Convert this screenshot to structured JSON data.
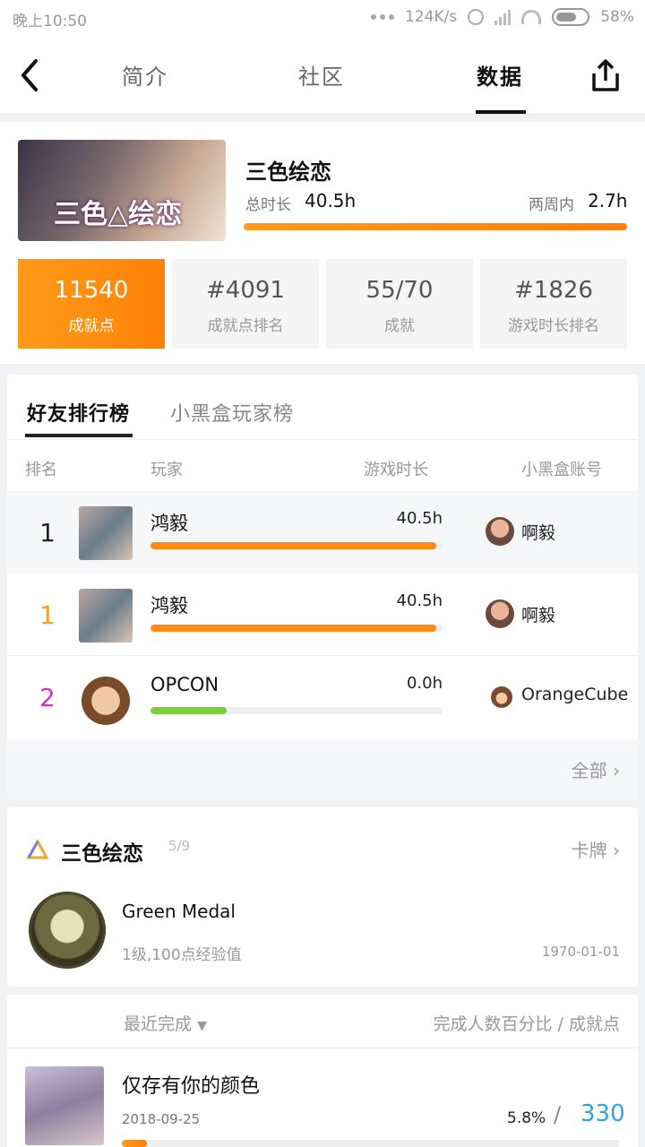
{
  "status_bar": {
    "time": "晚上10:50",
    "speed": "124K/s",
    "battery": "58%"
  },
  "nav": {
    "tabs": [
      {
        "label": "简介"
      },
      {
        "label": "社区"
      },
      {
        "label": "数据"
      }
    ],
    "active_tab": "数据"
  },
  "game": {
    "cover_text": "三色△绘恋",
    "title": "三色绘恋",
    "total_label": "总时长",
    "total_value": "40.5h",
    "recent_label": "两周内",
    "recent_value": "2.7h",
    "playtime_progress": 1.0,
    "stats": [
      {
        "value": "11540",
        "caption": "成就点"
      },
      {
        "value": "#4091",
        "caption": "成就点排名"
      },
      {
        "value": "55/70",
        "caption": "成就"
      },
      {
        "value": "#1826",
        "caption": "游戏时长排名"
      }
    ]
  },
  "leaderboard": {
    "tabs": [
      {
        "label": "好友排行榜"
      },
      {
        "label": "小黑盒玩家榜"
      }
    ],
    "columns": {
      "rank": "排名",
      "player": "玩家",
      "time": "游戏时长",
      "account": "小黑盒账号"
    },
    "rows": [
      {
        "rank": "1",
        "name": "鸿毅",
        "time": "40.5h",
        "account": "啊毅",
        "progress": 0.98,
        "rank_color": "#222222",
        "bar_color": "#ff8a12"
      },
      {
        "rank": "1",
        "name": "鸿毅",
        "time": "40.5h",
        "account": "啊毅",
        "progress": 0.98,
        "rank_color": "#f5a01f",
        "bar_color": "#ff8a12"
      },
      {
        "rank": "2",
        "name": "OPCON",
        "time": "0.0h",
        "account": "OrangeCube",
        "progress": 0.26,
        "rank_color": "#cc33cc",
        "bar_color": "#7ccf3a"
      }
    ],
    "more_label": "全部"
  },
  "achievements": {
    "title": "三色绘恋",
    "count": "5/9",
    "cards_label": "卡牌",
    "medal": {
      "name": "Green Medal",
      "desc": "1级,100点经验值",
      "date": "1970-01-01"
    }
  },
  "recent": {
    "sort_label": "最近完成",
    "right_label": "完成人数百分比 / 成就点",
    "item": {
      "title": "仅存有你的颜色",
      "date": "2018-09-25",
      "percent": "5.8%",
      "points": "330",
      "progress": 0.05
    }
  }
}
